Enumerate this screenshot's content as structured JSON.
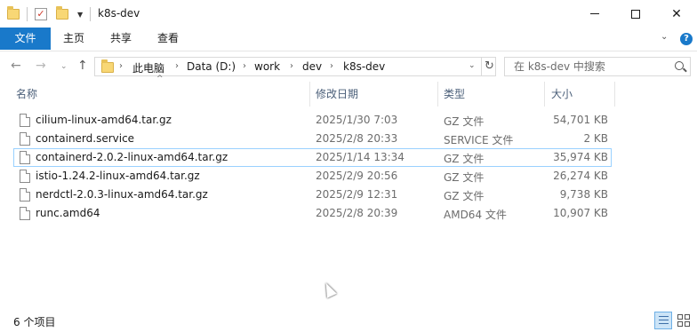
{
  "window": {
    "title": "k8s-dev",
    "minimize_label": "—",
    "maximize_label": "",
    "close_label": "✕"
  },
  "ribbon": {
    "tabs": [
      {
        "label": "文件"
      },
      {
        "label": "主页"
      },
      {
        "label": "共享"
      },
      {
        "label": "查看"
      }
    ],
    "help_label": "?"
  },
  "address": {
    "breadcrumbs": [
      "此电脑",
      "Data (D:)",
      "work",
      "dev",
      "k8s-dev"
    ]
  },
  "search": {
    "placeholder": "在 k8s-dev 中搜索"
  },
  "columns": {
    "name": "名称",
    "date": "修改日期",
    "type": "类型",
    "size": "大小"
  },
  "files": [
    {
      "name": "cilium-linux-amd64.tar.gz",
      "date": "2025/1/30 7:03",
      "type": "GZ 文件",
      "size": "54,701 KB"
    },
    {
      "name": "containerd.service",
      "date": "2025/2/8 20:33",
      "type": "SERVICE 文件",
      "size": "2 KB"
    },
    {
      "name": "containerd-2.0.2-linux-amd64.tar.gz",
      "date": "2025/1/14 13:34",
      "type": "GZ 文件",
      "size": "35,974 KB"
    },
    {
      "name": "istio-1.24.2-linux-amd64.tar.gz",
      "date": "2025/2/9 20:56",
      "type": "GZ 文件",
      "size": "26,274 KB"
    },
    {
      "name": "nerdctl-2.0.3-linux-amd64.tar.gz",
      "date": "2025/2/9 12:31",
      "type": "GZ 文件",
      "size": "9,738 KB"
    },
    {
      "name": "runc.amd64",
      "date": "2025/2/8 20:39",
      "type": "AMD64 文件",
      "size": "10,907 KB"
    }
  ],
  "status": {
    "item_count": "6 个项目"
  },
  "colors": {
    "accent": "#1979ca",
    "header_text": "#4c607a",
    "focus_border": "#99d1ff"
  }
}
